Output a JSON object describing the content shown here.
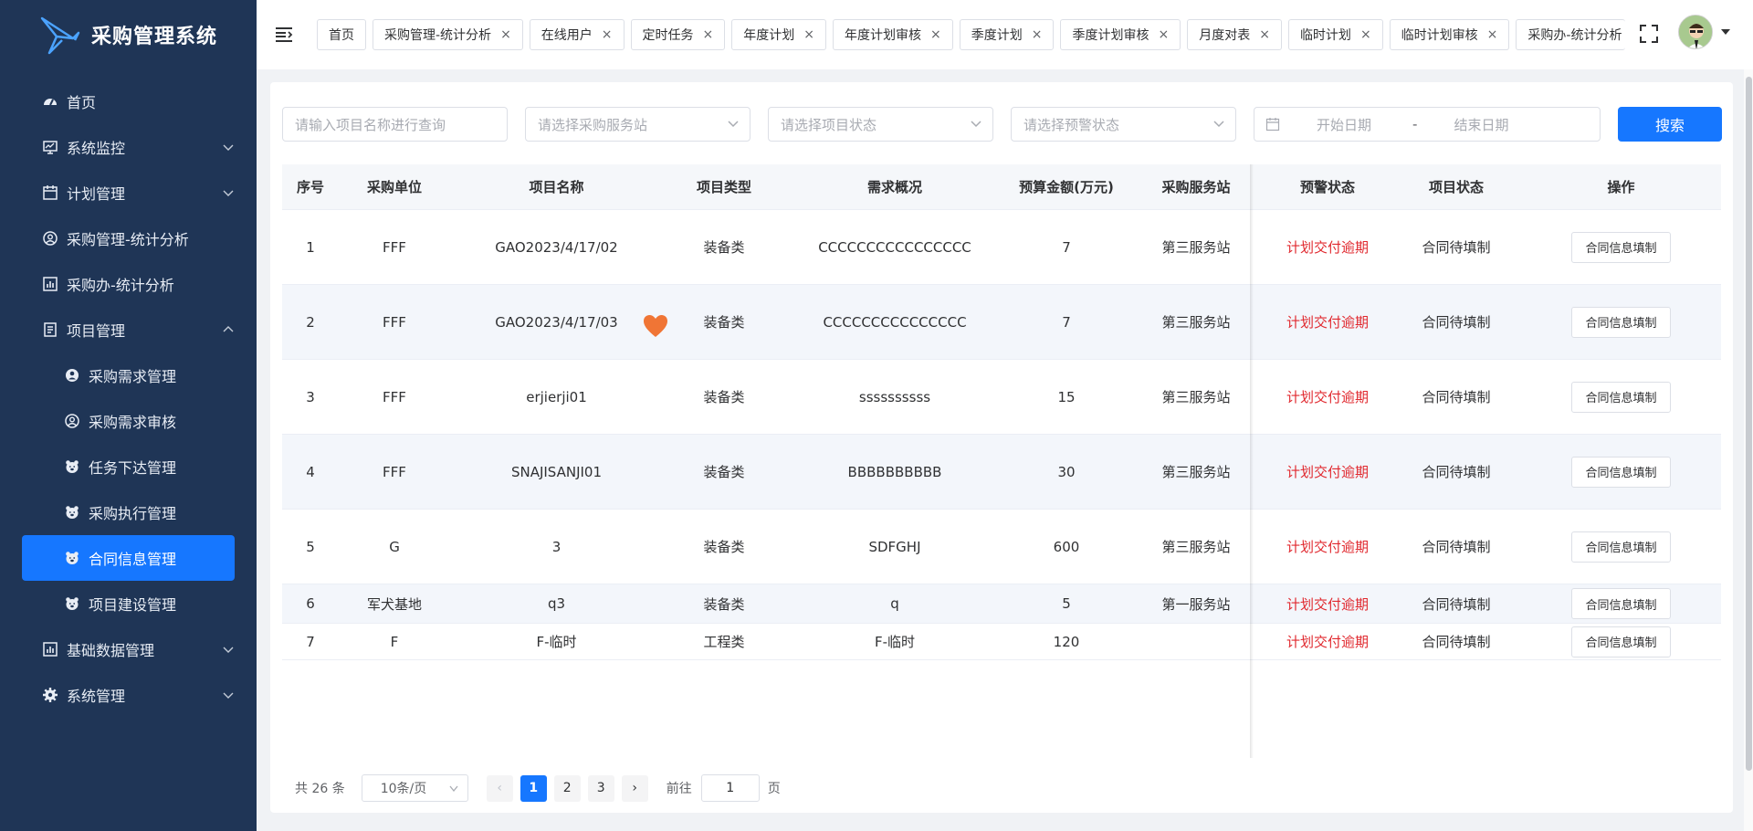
{
  "app": {
    "title": "采购管理系统"
  },
  "sidebar": {
    "items": [
      {
        "label": "首页",
        "icon": "dashboard-icon"
      },
      {
        "label": "系统监控",
        "icon": "monitor-icon",
        "expandable": true
      },
      {
        "label": "计划管理",
        "icon": "calendar-icon",
        "expandable": true
      },
      {
        "label": "采购管理-统计分析",
        "icon": "user-circle-icon"
      },
      {
        "label": "采购办-统计分析",
        "icon": "bar-chart-icon"
      },
      {
        "label": "项目管理",
        "icon": "document-icon",
        "expandable": true,
        "expanded": true
      }
    ],
    "project_submenu": [
      {
        "label": "采购需求管理",
        "icon": "user-fill-icon"
      },
      {
        "label": "采购需求审核",
        "icon": "user-circle-icon"
      },
      {
        "label": "任务下达管理",
        "icon": "bear-icon"
      },
      {
        "label": "采购执行管理",
        "icon": "bear-icon"
      },
      {
        "label": "合同信息管理",
        "icon": "bear-icon",
        "active": true
      },
      {
        "label": "项目建设管理",
        "icon": "bear-icon"
      }
    ],
    "bottom_items": [
      {
        "label": "基础数据管理",
        "icon": "bar-chart-icon",
        "expandable": true
      },
      {
        "label": "系统管理",
        "icon": "gear-icon",
        "expandable": true
      }
    ]
  },
  "tabs": [
    {
      "label": "首页",
      "closable": false
    },
    {
      "label": "采购管理-统计分析",
      "closable": true
    },
    {
      "label": "在线用户",
      "closable": true
    },
    {
      "label": "定时任务",
      "closable": true
    },
    {
      "label": "年度计划",
      "closable": true
    },
    {
      "label": "年度计划审核",
      "closable": true
    },
    {
      "label": "季度计划",
      "closable": true
    },
    {
      "label": "季度计划审核",
      "closable": true
    },
    {
      "label": "月度对表",
      "closable": true
    },
    {
      "label": "临时计划",
      "closable": true
    },
    {
      "label": "临时计划审核",
      "closable": true
    },
    {
      "label": "采购办-统计分析",
      "closable": false,
      "truncated": true
    }
  ],
  "filters": {
    "project_name_placeholder": "请输入项目名称进行查询",
    "station_placeholder": "请选择采购服务站",
    "status_placeholder": "请选择项目状态",
    "warning_placeholder": "请选择预警状态",
    "start_date_placeholder": "开始日期",
    "date_separator": "-",
    "end_date_placeholder": "结束日期",
    "search_label": "搜索"
  },
  "table": {
    "columns": [
      "序号",
      "采购单位",
      "项目名称",
      "项目类型",
      "需求概况",
      "预算金额(万元)",
      "采购服务站",
      "预警状态",
      "项目状态",
      "操作"
    ],
    "rows": [
      {
        "no": "1",
        "unit": "FFF",
        "name": "GAO2023/4/17/02",
        "type": "装备类",
        "summary": "CCCCCCCCCCCCCCCC",
        "budget": "7",
        "station": "第三服务站",
        "warning": "计划交付逾期",
        "status": "合同待填制",
        "action": "合同信息填制"
      },
      {
        "no": "2",
        "unit": "FFF",
        "name": "GAO2023/4/17/03",
        "type": "装备类",
        "summary": "CCCCCCCCCCCCCCC",
        "budget": "7",
        "station": "第三服务站",
        "warning": "计划交付逾期",
        "status": "合同待填制",
        "action": "合同信息填制"
      },
      {
        "no": "3",
        "unit": "FFF",
        "name": "erjierji01",
        "type": "装备类",
        "summary": "ssssssssss",
        "budget": "15",
        "station": "第三服务站",
        "warning": "计划交付逾期",
        "status": "合同待填制",
        "action": "合同信息填制"
      },
      {
        "no": "4",
        "unit": "FFF",
        "name": "SNAJISANJI01",
        "type": "装备类",
        "summary": "BBBBBBBBBB",
        "budget": "30",
        "station": "第三服务站",
        "warning": "计划交付逾期",
        "status": "合同待填制",
        "action": "合同信息填制"
      },
      {
        "no": "5",
        "unit": "G",
        "name": "3",
        "type": "装备类",
        "summary": "SDFGHJ",
        "budget": "600",
        "station": "第三服务站",
        "warning": "计划交付逾期",
        "status": "合同待填制",
        "action": "合同信息填制"
      },
      {
        "no": "6",
        "unit": "军犬基地",
        "name": "q3",
        "type": "装备类",
        "summary": "q",
        "budget": "5",
        "station": "第一服务站",
        "warning": "计划交付逾期",
        "status": "合同待填制",
        "action": "合同信息填制"
      },
      {
        "no": "7",
        "unit": "F",
        "name": "F-临时",
        "type": "工程类",
        "summary": "F-临时",
        "budget": "120",
        "station": "",
        "warning": "计划交付逾期",
        "status": "合同待填制",
        "action": "合同信息填制"
      }
    ]
  },
  "pagination": {
    "total": "共 26 条",
    "page_size": "10条/页",
    "pages": [
      "1",
      "2",
      "3"
    ],
    "current_page": "1",
    "goto_prefix": "前往",
    "goto_value": "1",
    "goto_suffix": "页"
  },
  "colors": {
    "sidebar_bg": "#1f3556",
    "accent": "#1677ff",
    "warning_text": "#e0282e",
    "heart": "#f07535"
  }
}
